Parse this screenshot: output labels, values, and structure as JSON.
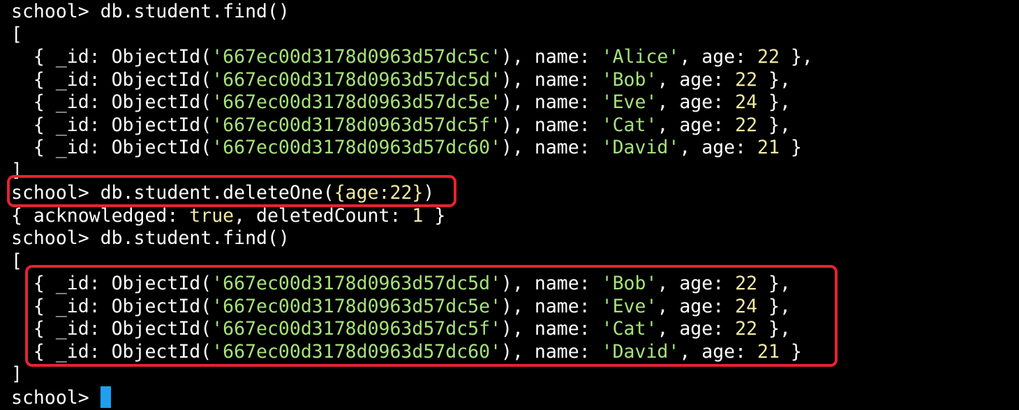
{
  "prompt": "school>",
  "block1": {
    "command": "db.student.find()",
    "open": "[",
    "rows": [
      {
        "id": "667ec00d3178d0963d57dc5c",
        "name": "Alice",
        "age": "22",
        "tail": " },"
      },
      {
        "id": "667ec00d3178d0963d57dc5d",
        "name": "Bob",
        "age": "22",
        "tail": " },"
      },
      {
        "id": "667ec00d3178d0963d57dc5e",
        "name": "Eve",
        "age": "24",
        "tail": " },"
      },
      {
        "id": "667ec00d3178d0963d57dc5f",
        "name": "Cat",
        "age": "22",
        "tail": " },"
      },
      {
        "id": "667ec00d3178d0963d57dc60",
        "name": "David",
        "age": "21",
        "tail": " }"
      }
    ],
    "close": "]"
  },
  "delete": {
    "command_pre": "db.student.deleteOne(",
    "arg_open": "{",
    "arg_key": "age:",
    "arg_value": "22",
    "arg_close": "}",
    "command_post": ")",
    "result_pre": "{ acknowledged: ",
    "result_ack": "true",
    "result_mid": ", deletedCount: ",
    "result_count": "1",
    "result_post": " }"
  },
  "block2": {
    "command": "db.student.find()",
    "open": "[",
    "rows": [
      {
        "id": "667ec00d3178d0963d57dc5d",
        "name": "Bob",
        "age": "22",
        "tail": " },"
      },
      {
        "id": "667ec00d3178d0963d57dc5e",
        "name": "Eve",
        "age": "24",
        "tail": " },"
      },
      {
        "id": "667ec00d3178d0963d57dc5f",
        "name": "Cat",
        "age": "22",
        "tail": " },"
      },
      {
        "id": "667ec00d3178d0963d57dc60",
        "name": "David",
        "age": "21",
        "tail": " }"
      }
    ],
    "close": "]"
  },
  "colors": {
    "background": "#000000",
    "text": "#ffffff",
    "string": "#a6e27a",
    "number": "#f2e9a2",
    "cursor": "#1ea0ef",
    "highlight": "#e8222f"
  }
}
